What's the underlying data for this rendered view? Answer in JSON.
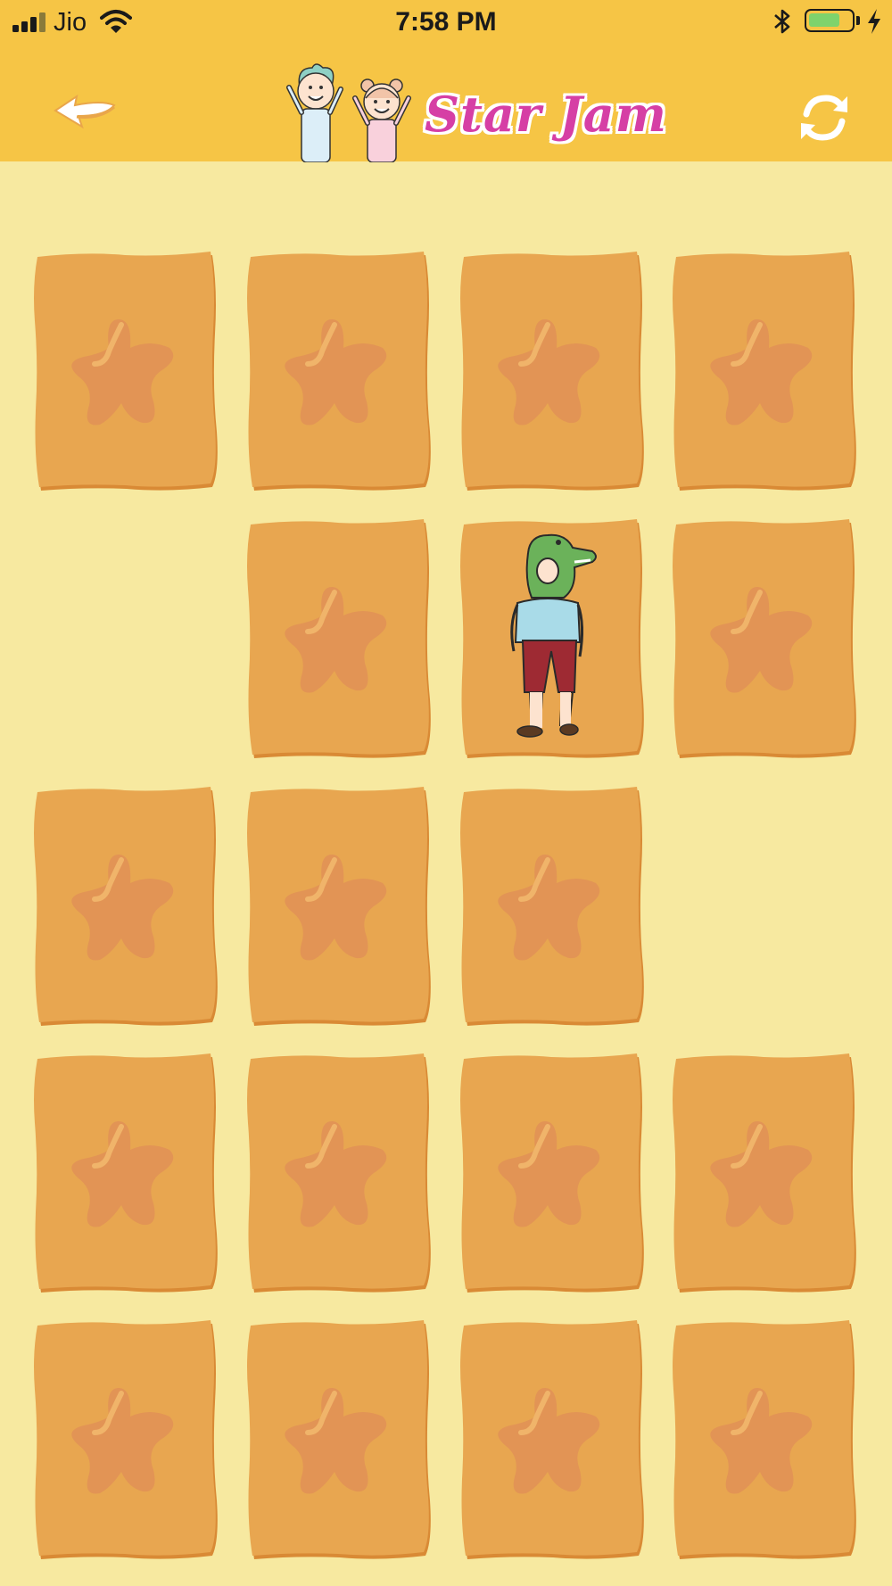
{
  "status_bar": {
    "carrier": "Jio",
    "time": "7:58 PM",
    "battery_level": 0.75
  },
  "app_bar": {
    "title": "Star Jam",
    "back_icon": "back-arrow-icon",
    "reload_icon": "reload-icon"
  },
  "board": {
    "columns": 4,
    "rows": 5,
    "cards": [
      {
        "state": "face-down"
      },
      {
        "state": "face-down"
      },
      {
        "state": "face-down"
      },
      {
        "state": "face-down"
      },
      {
        "state": "removed"
      },
      {
        "state": "face-down"
      },
      {
        "state": "face-up",
        "image": "crocodile-mask-boy"
      },
      {
        "state": "face-down"
      },
      {
        "state": "face-down"
      },
      {
        "state": "face-down"
      },
      {
        "state": "face-down"
      },
      {
        "state": "removed"
      },
      {
        "state": "face-down"
      },
      {
        "state": "face-down"
      },
      {
        "state": "face-down"
      },
      {
        "state": "face-down"
      },
      {
        "state": "face-down"
      },
      {
        "state": "face-down"
      },
      {
        "state": "face-down"
      },
      {
        "state": "face-down"
      }
    ]
  },
  "colors": {
    "header": "#f6c545",
    "background": "#f7e9a0",
    "card": "#e8a650",
    "card_edge": "#d98a35",
    "star": "#e29455",
    "title": "#d63fa5"
  }
}
